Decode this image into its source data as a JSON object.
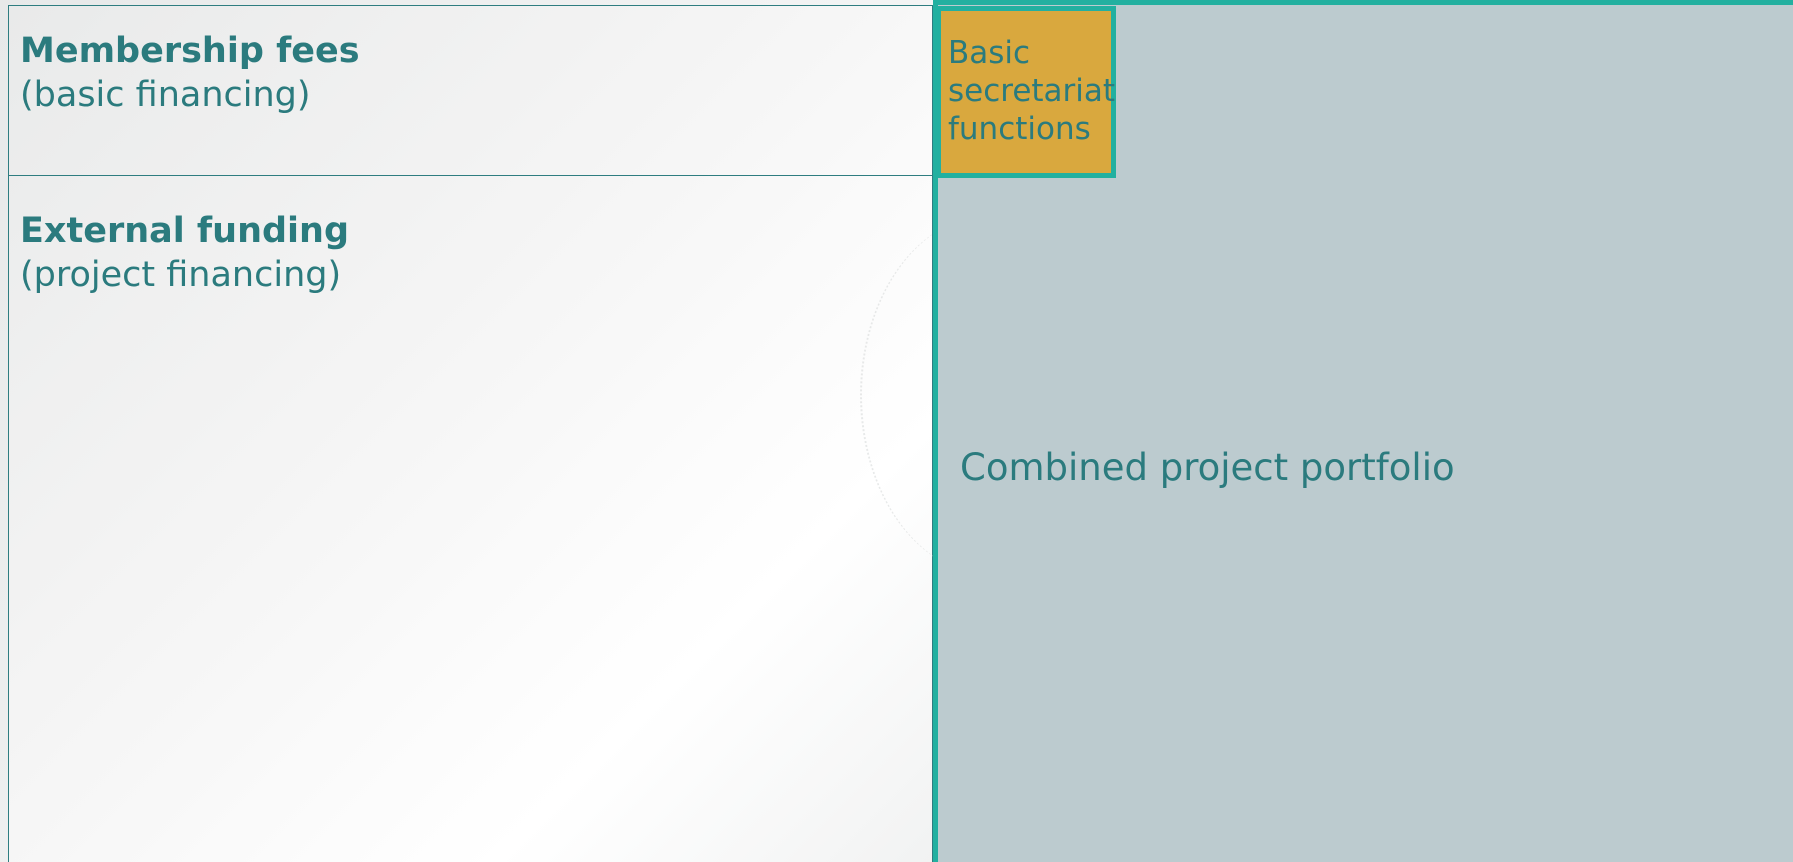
{
  "left": {
    "membership": {
      "title": "Membership fees",
      "subtitle": "(basic financing)"
    },
    "external": {
      "title": "External funding",
      "subtitle": "(project financing)"
    }
  },
  "right": {
    "secretariat_label": "Basic secretariat functions",
    "portfolio_label": "Combined project portfolio"
  },
  "colors": {
    "text_teal": "#2b7b7e",
    "border_teal": "#22b0a0",
    "right_panel_fill": "#bccbcf",
    "secretariat_fill": "#d9a83e"
  }
}
